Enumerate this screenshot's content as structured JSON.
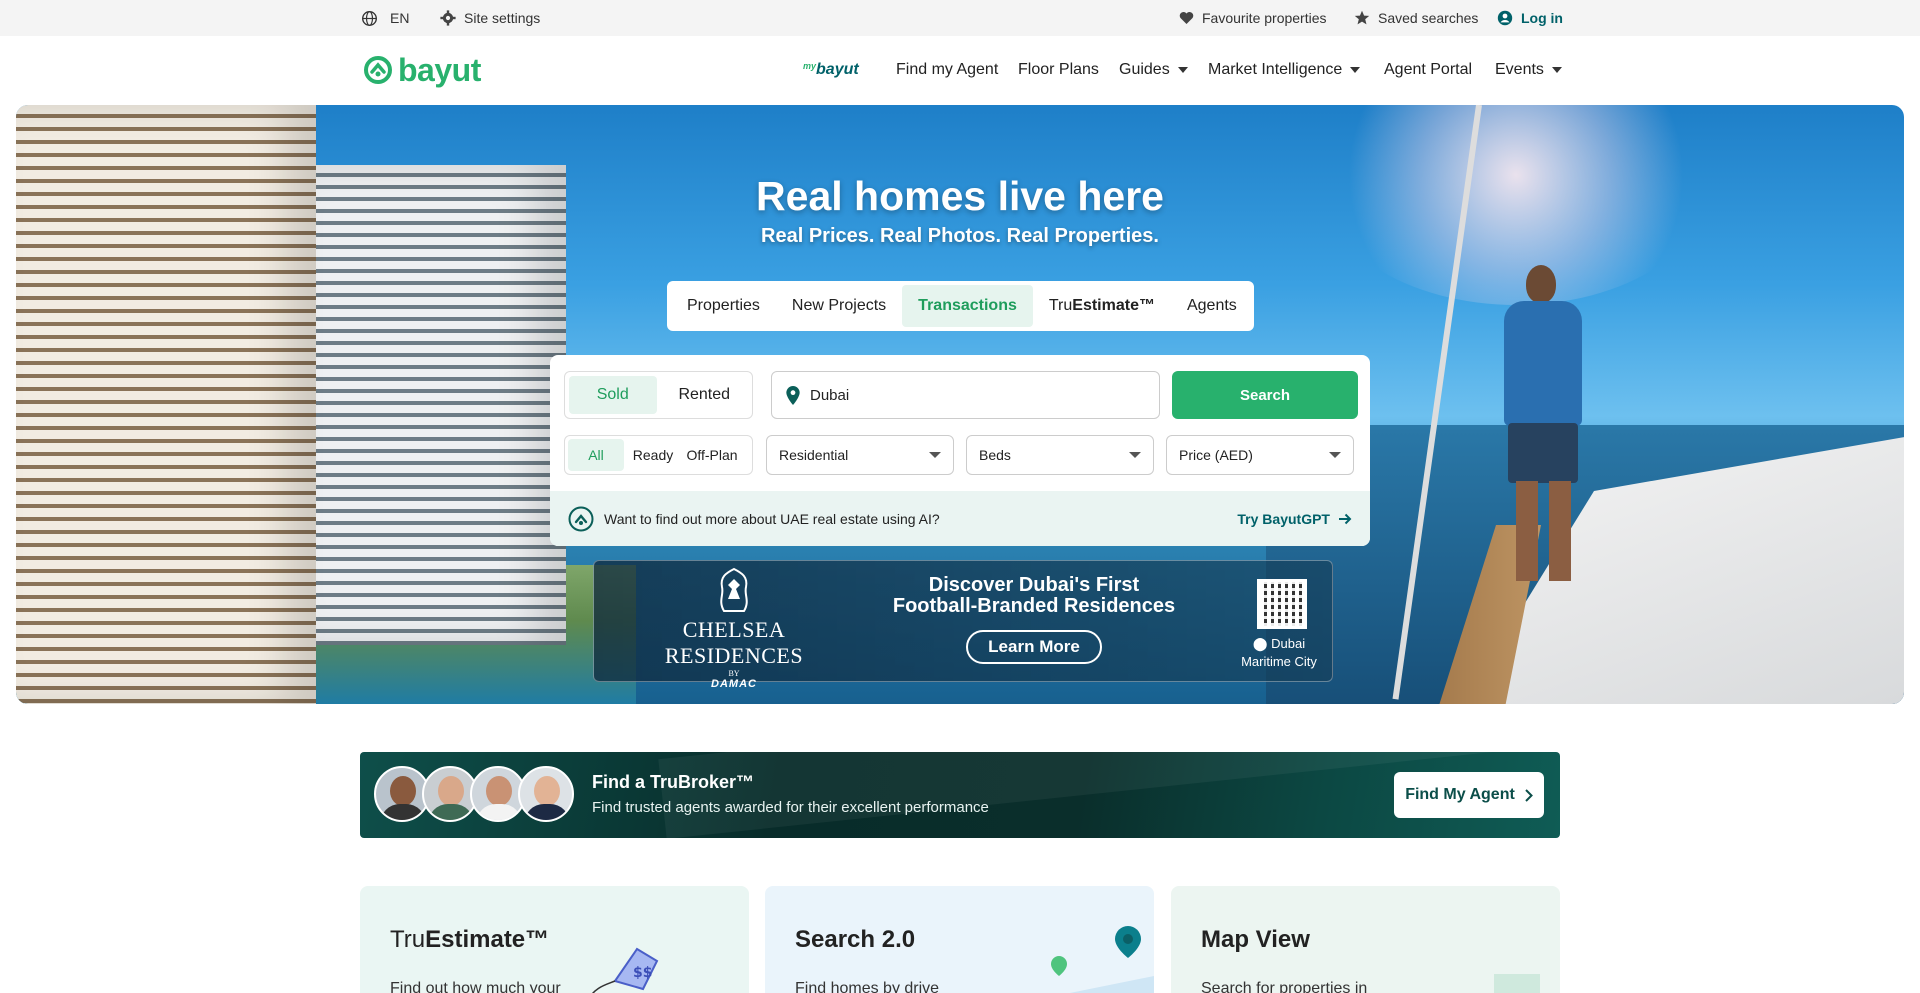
{
  "topbar": {
    "language": "EN",
    "site_settings": "Site settings",
    "favourites": "Favourite properties",
    "saved_searches": "Saved searches",
    "login": "Log in"
  },
  "header": {
    "logo": "bayut",
    "mybayut_prefix": "my",
    "mybayut": "bayut",
    "nav": [
      "Find my Agent",
      "Floor Plans",
      "Guides",
      "Market Intelligence",
      "Agent Portal",
      "Events"
    ]
  },
  "hero": {
    "title": "Real homes live here",
    "subtitle": "Real Prices. Real Photos. Real Properties.",
    "tabs": [
      "Properties",
      "New Projects",
      "Transactions",
      "Tru",
      "Estimate™",
      "Agents"
    ],
    "active_tab": "Transactions"
  },
  "search": {
    "status_options": [
      "Sold",
      "Rented"
    ],
    "completion_options": [
      "All",
      "Ready",
      "Off-Plan"
    ],
    "location_value": "Dubai",
    "search_label": "Search",
    "category": "Residential",
    "beds": "Beds",
    "price": "Price (AED)",
    "ai_prompt": "Want to find out more about UAE real estate using AI?",
    "ai_link": "Try BayutGPT"
  },
  "ad": {
    "brand_name": "CHELSEA RESIDENCES",
    "brand_by": "BY",
    "brand_damac": "DAMAC",
    "headline_1": "Discover Dubai's First",
    "headline_2": "Football-Branded Residences",
    "cta": "Learn More",
    "location_1": "Dubai",
    "location_2": "Maritime City"
  },
  "trubroker": {
    "title": "Find a TruBroker™",
    "description": "Find trusted agents awarded for their excellent performance",
    "button": "Find My Agent"
  },
  "cards": [
    {
      "title_light": "Tru",
      "title_bold": "Estimate™",
      "description": "Find out how much your",
      "bg": "#eaf6f3"
    },
    {
      "title_light": "",
      "title_bold": "Search 2.0",
      "description": "Find homes by drive",
      "bg": "#eaf4fb"
    },
    {
      "title_light": "",
      "title_bold": "Map View",
      "description": "Search for properties in",
      "bg": "#ecf5f1"
    }
  ],
  "colors": {
    "brand_green": "#28b16d",
    "brand_teal": "#006169",
    "active_tab_bg": "#e6f4ee"
  }
}
